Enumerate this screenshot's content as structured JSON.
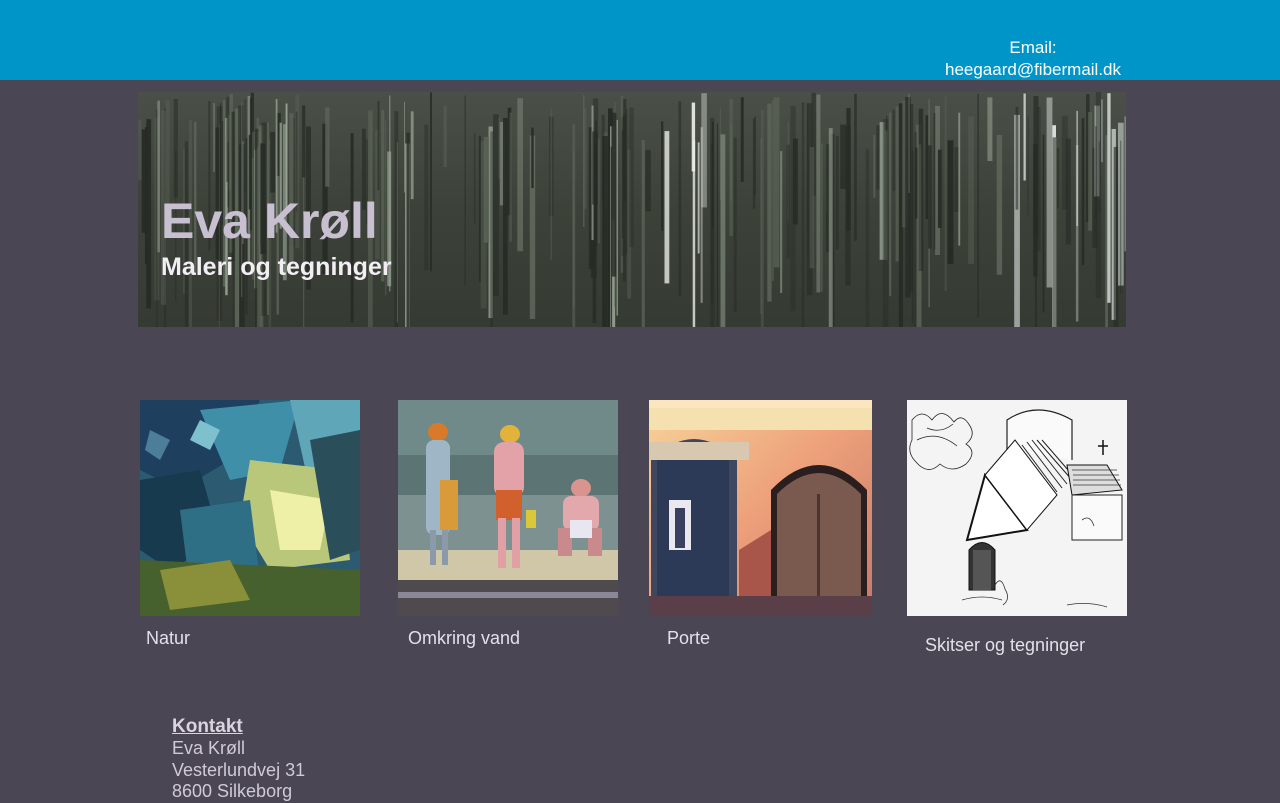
{
  "header": {
    "email_label": "Email:",
    "email_address": "heegaard@fibermail.dk"
  },
  "banner": {
    "title": "Eva Krøll",
    "subtitle": "Maleri og tegninger"
  },
  "gallery": [
    {
      "caption": "Natur"
    },
    {
      "caption": "Omkring vand"
    },
    {
      "caption": "Porte"
    },
    {
      "caption": "Skitser og tegninger"
    }
  ],
  "contact": {
    "heading": "Kontakt",
    "name": "Eva Krøll",
    "street": "Vesterlundvej 31",
    "city": "8600 Silkeborg"
  },
  "colors": {
    "header_bg": "#0095c9",
    "page_bg": "#4a4653"
  }
}
